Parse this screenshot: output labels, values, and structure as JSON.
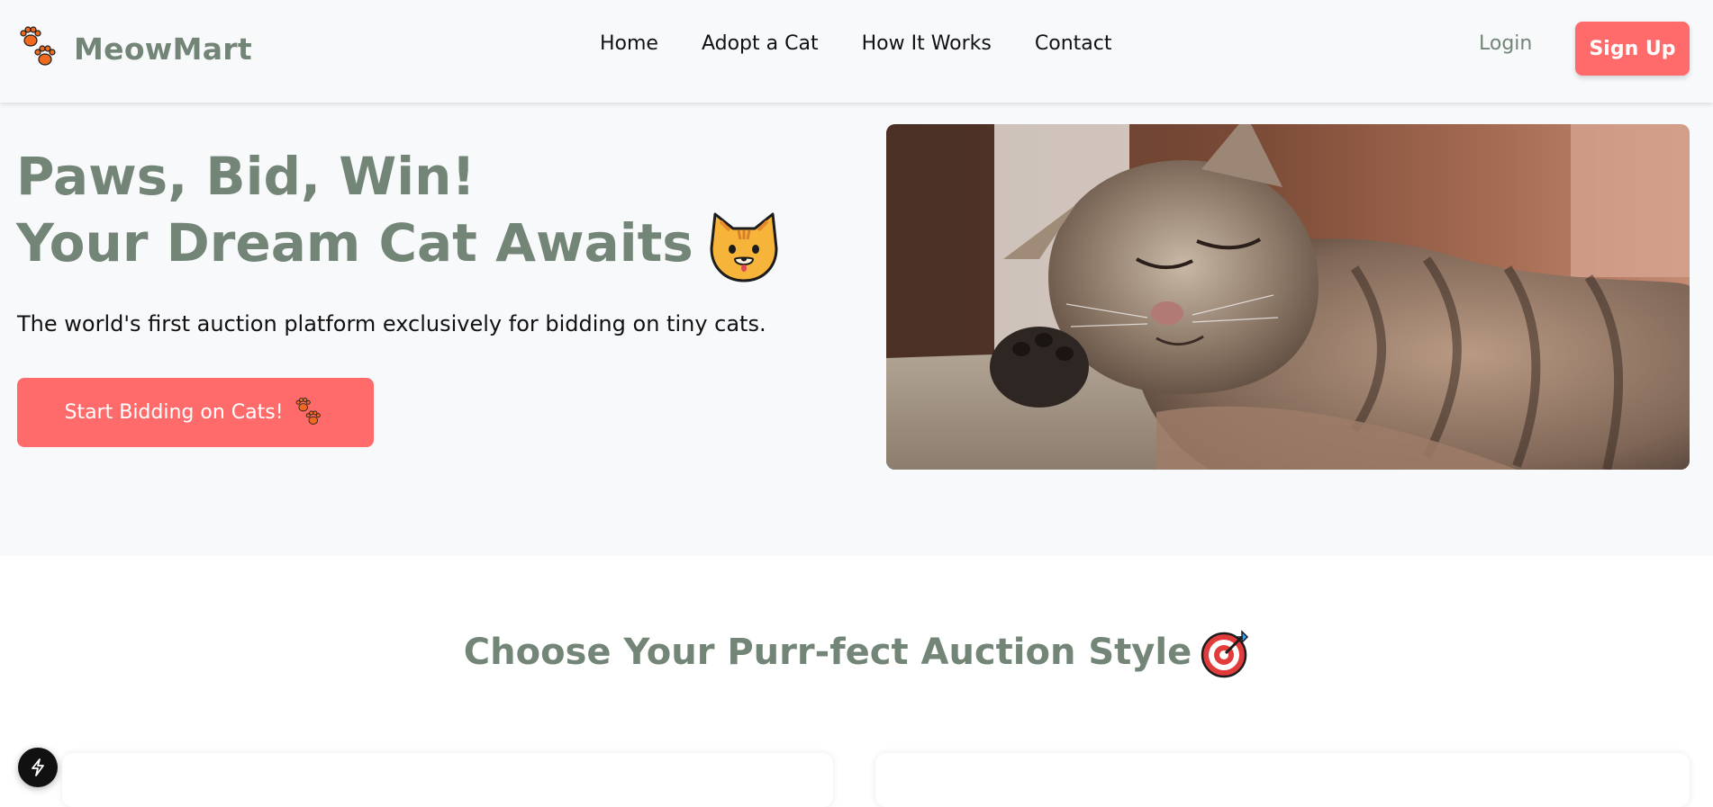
{
  "brand": {
    "name": "MeowMart",
    "logo_icon": "paw-prints-icon"
  },
  "nav": {
    "links": [
      {
        "label": "Home"
      },
      {
        "label": "Adopt a Cat"
      },
      {
        "label": "How It Works"
      },
      {
        "label": "Contact"
      }
    ],
    "login_label": "Login",
    "signup_label": "Sign Up"
  },
  "hero": {
    "title_line1": "Paws, Bid, Win!",
    "title_line2": "Your Dream Cat Awaits",
    "title_icon": "cat-face-icon",
    "subtitle": "The world's first auction platform exclusively for bidding on tiny cats.",
    "cta_label": "Start Bidding on Cats!",
    "cta_icon": "paw-prints-icon",
    "image": "sleeping-tabby-kitten"
  },
  "auction_section": {
    "title": "Choose Your Purr-fect Auction Style",
    "title_icon": "target-icon"
  },
  "colors": {
    "accent": "#ff6b6b",
    "brand_green": "#738577",
    "background": "#f8f9fb"
  }
}
